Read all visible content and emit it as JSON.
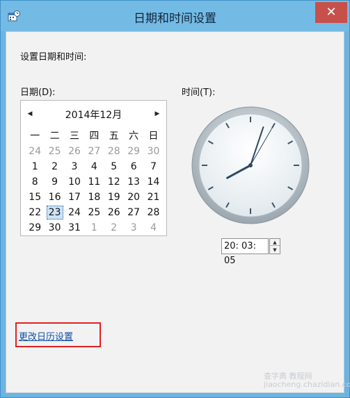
{
  "window": {
    "title": "日期和时间设置",
    "close_glyph": "✕"
  },
  "labels": {
    "heading": "设置日期和时间:",
    "date": "日期(D):",
    "time": "时间(T):"
  },
  "calendar": {
    "month_label": "2014年12月",
    "prev_glyph": "◀",
    "next_glyph": "▶",
    "weekdays": [
      "一",
      "二",
      "三",
      "四",
      "五",
      "六",
      "日"
    ],
    "weeks": [
      [
        "24",
        "25",
        "26",
        "27",
        "28",
        "29",
        "30"
      ],
      [
        "1",
        "2",
        "3",
        "4",
        "5",
        "6",
        "7"
      ],
      [
        "8",
        "9",
        "10",
        "11",
        "12",
        "13",
        "14"
      ],
      [
        "15",
        "16",
        "17",
        "18",
        "19",
        "20",
        "21"
      ],
      [
        "22",
        "23",
        "24",
        "25",
        "26",
        "27",
        "28"
      ],
      [
        "29",
        "30",
        "31",
        "1",
        "2",
        "3",
        "4"
      ]
    ],
    "selected_day": "23"
  },
  "clock": {
    "hour": 20,
    "minute": 3,
    "second": 5
  },
  "time_value": "20: 03: 05",
  "link_text": "更改日历设置",
  "watermark": "查字典 教程网 jiaocheng.chazidian.com",
  "colors": {
    "title_bar": "#73bbe4",
    "close_button": "#c7504a",
    "link": "#0f4fa8",
    "highlight": "#e02020"
  }
}
